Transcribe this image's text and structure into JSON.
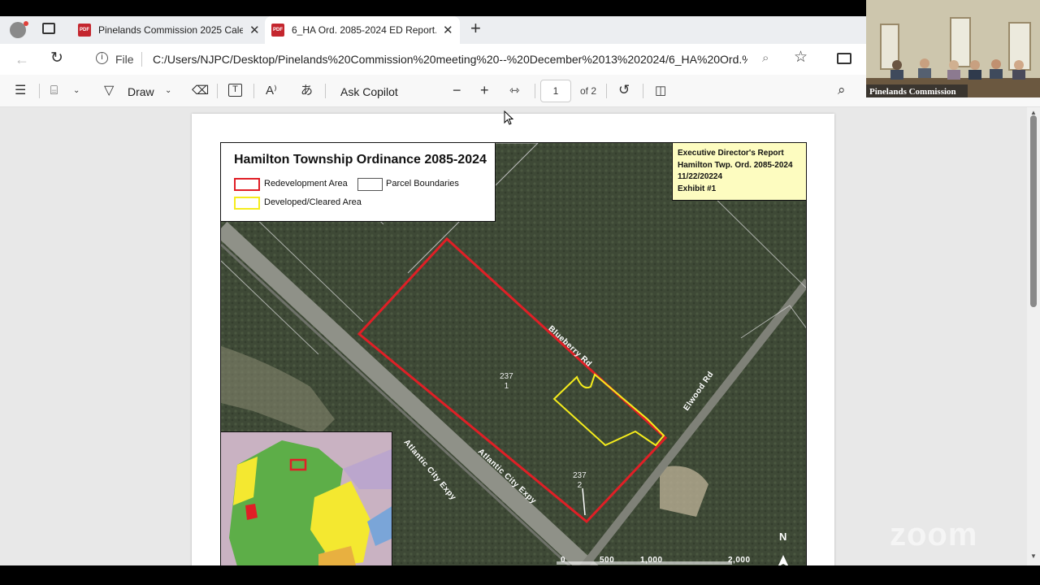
{
  "browser": {
    "tabs": [
      {
        "title": "Pinelands Commission 2025 Calen",
        "close": "✕"
      },
      {
        "title": "6_HA Ord. 2085-2024 ED Report.p",
        "close": "✕"
      }
    ],
    "new_tab": "+",
    "file_label": "File",
    "url": "C:/Users/NJPC/Desktop/Pinelands%20Commission%20meeting%20--%20December%2013%202024/6_HA%20Ord.%..."
  },
  "pdf_toolbar": {
    "draw_label": "Draw",
    "ask_copilot": "Ask Copilot",
    "page_current": "1",
    "page_total": "of 2"
  },
  "map": {
    "title": "Hamilton Township Ordinance 2085-2024",
    "legend": {
      "redevelopment": "Redevelopment Area",
      "parcel": "Parcel Boundaries",
      "developed": "Developed/Cleared Area"
    },
    "exhibit": {
      "line1": "Executive Director's Report",
      "line2": "Hamilton Twp. Ord. 2085-2024",
      "line3": "11/22/20224",
      "line4": "Exhibit #1"
    },
    "roads": {
      "blueberry": "Blueberry Rd",
      "elwood": "Elwood Rd",
      "ace1": "Atlantic City Expy",
      "ace2": "Atlantic City Expy"
    },
    "parcels": {
      "p1a": "237",
      "p1b": "1",
      "p2a": "237",
      "p2b": "2"
    },
    "scale": {
      "s0": "0",
      "s500": "500",
      "s1000": "1,000",
      "s2000": "2,000"
    },
    "north": "N"
  },
  "video": {
    "label": "Pinelands Commission",
    "watermark": "zoom"
  },
  "colors": {
    "redevelopment": "#e01f26",
    "developed": "#f5ec1c",
    "exhibit_bg": "#fdfcc0"
  }
}
